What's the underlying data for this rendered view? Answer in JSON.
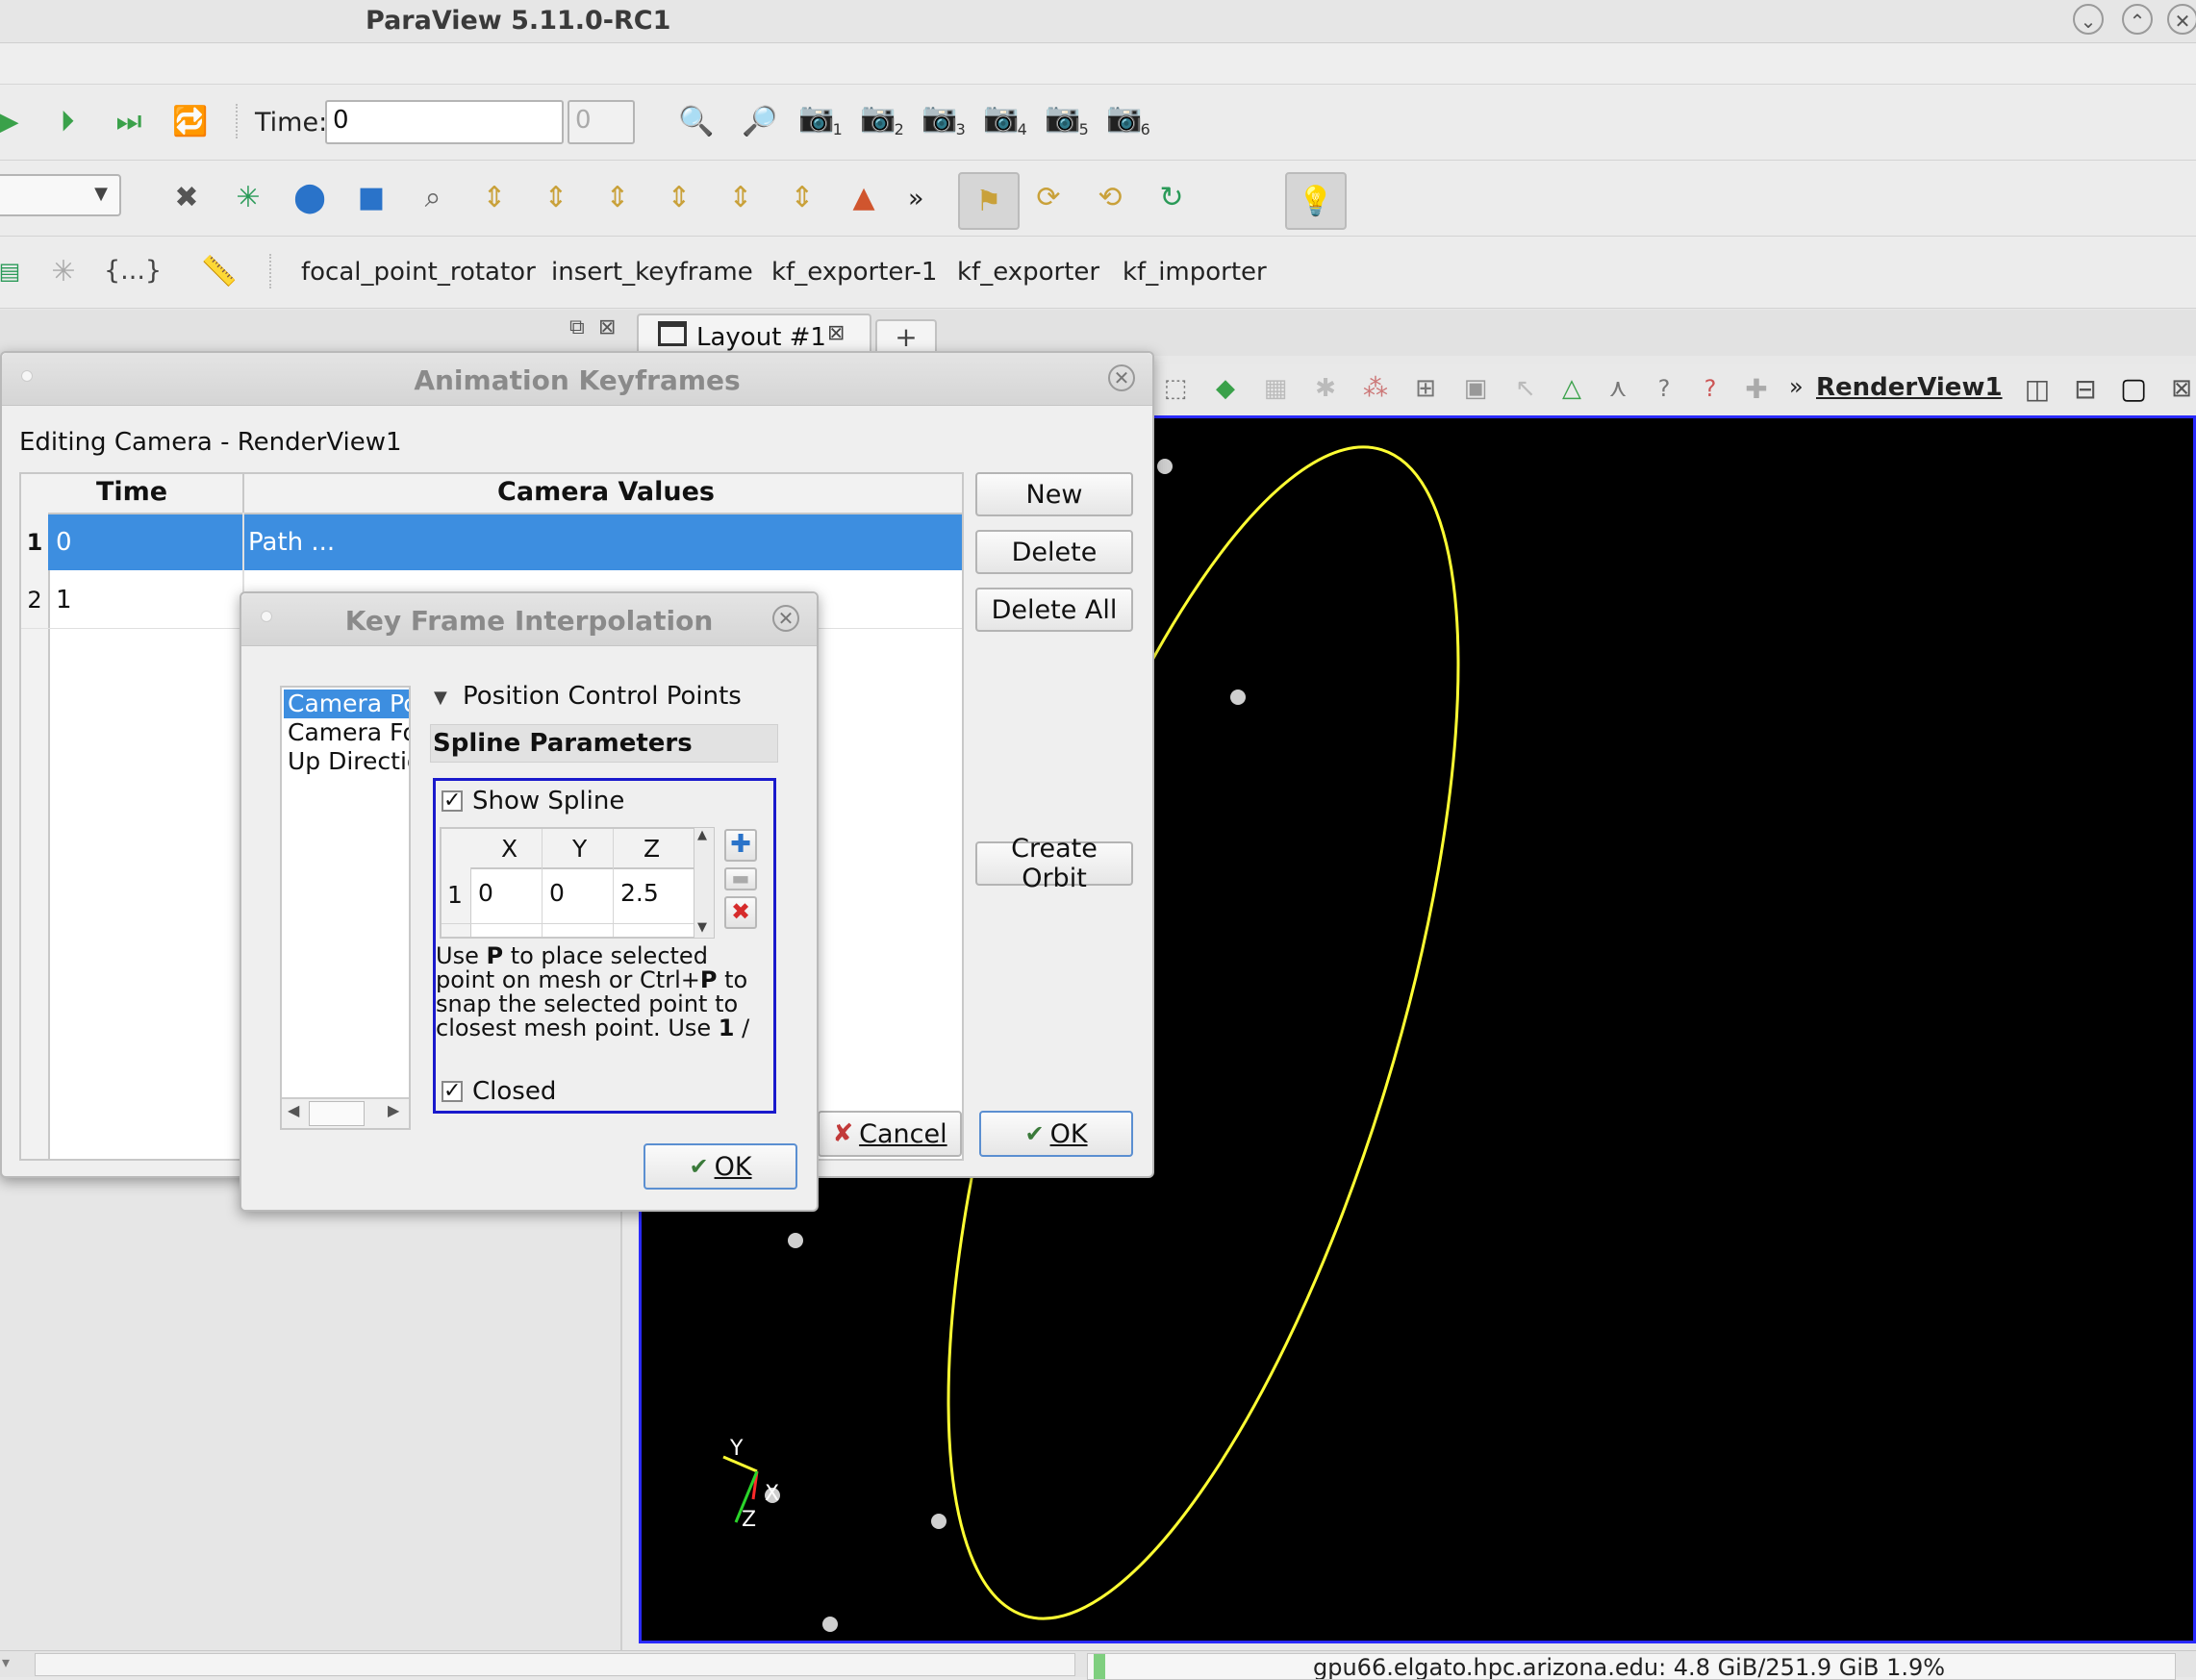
{
  "window": {
    "title": "ParaView 5.11.0-RC1",
    "controls": [
      "⌄",
      "⌃",
      "✕"
    ]
  },
  "time_toolbar": {
    "label": "Time:",
    "value": "0",
    "step": "0"
  },
  "camera_presets": [
    "1",
    "2",
    "3",
    "4",
    "5",
    "6"
  ],
  "view_toolbar_more": "»",
  "macros": [
    "focal_point_rotator",
    "insert_keyframe",
    "kf_exporter-1",
    "kf_exporter",
    "kf_importer"
  ],
  "macro_prefix": "{...}",
  "layout_tabs": {
    "tab": "Layout #1",
    "add": "+"
  },
  "view": {
    "more": "»",
    "name": "RenderView1"
  },
  "animation_dialog": {
    "title": "Animation Keyframes",
    "subtitle": "Editing Camera - RenderView1",
    "columns": [
      "Time",
      "Camera Values"
    ],
    "rows": [
      {
        "index": "1",
        "time": "0",
        "value": "Path ..."
      },
      {
        "index": "2",
        "time": "1",
        "value": ""
      }
    ],
    "buttons": {
      "new": "New",
      "delete": "Delete",
      "delete_all": "Delete All",
      "create_orbit": "Create Orbit",
      "cancel": "Cancel",
      "ok": "OK"
    }
  },
  "interp_dialog": {
    "title": "Key Frame Interpolation",
    "list": [
      "Camera Po",
      "Camera Fo",
      "Up Directio"
    ],
    "section": "Position Control Points",
    "group": "Spline Parameters",
    "show_spline": "Show Spline",
    "points_columns": [
      "X",
      "Y",
      "Z"
    ],
    "points": [
      {
        "row": "1",
        "x": "0",
        "y": "0",
        "z": "2.5"
      }
    ],
    "help_lines": [
      "Use P to place selected",
      "point on mesh or Ctrl+P to",
      "snap the selected point to",
      "closest mesh point. Use 1 /"
    ],
    "closed": "Closed",
    "ok": "OK"
  },
  "axes": {
    "x": "X",
    "y": "Y",
    "z": "Z"
  },
  "status": {
    "memory": "gpu66.elgato.hpc.arizona.edu: 4.8 GiB/251.9 GiB 1.9%"
  },
  "colors": {
    "accent": "#3d8ee0",
    "spline": "#ffff00",
    "selection_border": "#1a1acc",
    "render_bg": "#000000"
  }
}
